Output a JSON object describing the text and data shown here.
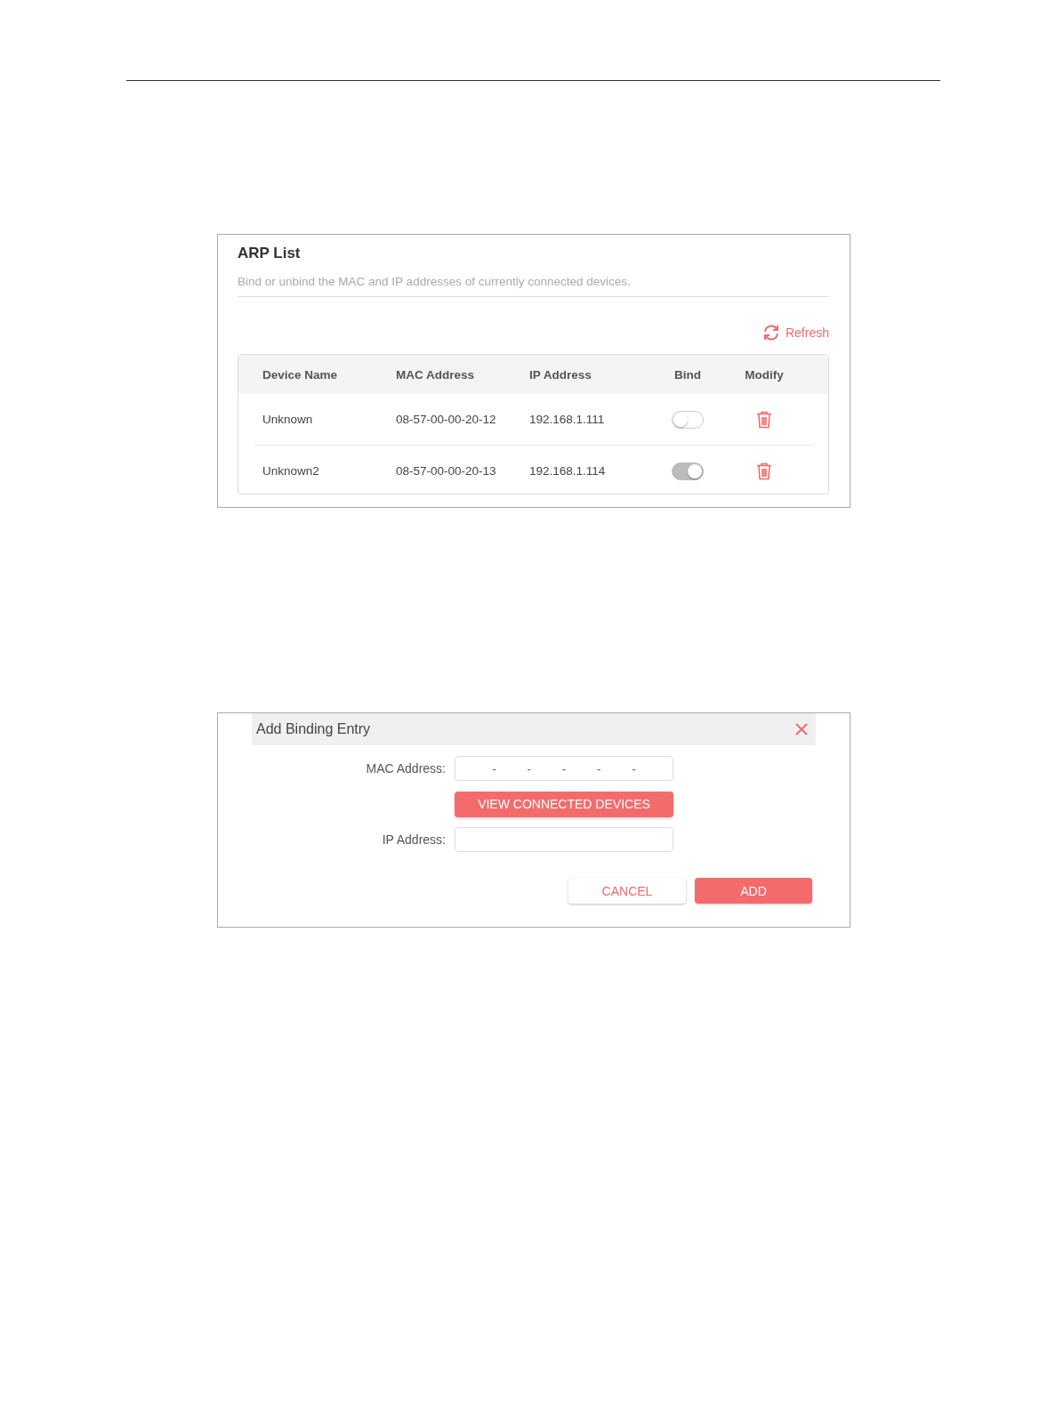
{
  "arp_list": {
    "title": "ARP List",
    "description": "Bind or unbind the MAC and IP addresses of currently connected devices.",
    "refresh": "Refresh",
    "columns": [
      "Device Name",
      "MAC Address",
      "IP Address",
      "Bind",
      "Modify"
    ],
    "rows": [
      {
        "device_name": "Unknown",
        "mac_address": "08-57-00-00-20-12",
        "ip_address": "192.168.1.111",
        "bind": false
      },
      {
        "device_name": "Unknown2",
        "mac_address": "08-57-00-00-20-13",
        "ip_address": "192.168.1.114",
        "bind": true
      }
    ]
  },
  "dialog": {
    "title": "Add Binding Entry",
    "mac_label": "MAC Address:",
    "mac_separators": [
      "-",
      "-",
      "-",
      "-",
      "-"
    ],
    "view_button": "VIEW CONNECTED DEVICES",
    "ip_label": "IP Address:",
    "cancel": "CANCEL",
    "add": "ADD"
  }
}
